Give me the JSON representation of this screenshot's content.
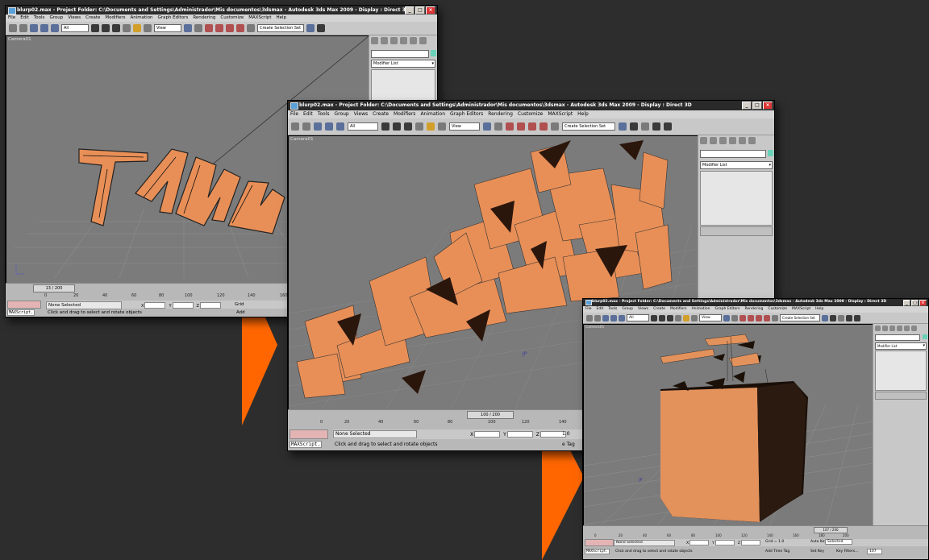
{
  "accent": {
    "arrow": "#ff6600",
    "object": "#e88f57",
    "titlebar": "#2a2a2a",
    "viewport": "#7b7b7b"
  },
  "menu": [
    "File",
    "Edit",
    "Tools",
    "Group",
    "Views",
    "Create",
    "Modifiers",
    "Animation",
    "Graph Editors",
    "Rendering",
    "Customize",
    "MAXScript",
    "Help"
  ],
  "window1": {
    "title": "blurp02.max    - Project Folder: C:\\Documents and Settings\\Administrador\\Mis documentos\\3dsmax    - Autodesk 3ds Max  2009    - Display : Direct 3D",
    "filter": "All",
    "refcoord": "View",
    "selset": "Create Selection Set",
    "viewport_label": "Camera01",
    "modifier_list": "Modifier List",
    "time_slider": "13 / 200",
    "ticks": [
      "0",
      "20",
      "40",
      "60",
      "80",
      "100",
      "120",
      "140",
      "160"
    ],
    "selection": "None Selected",
    "prompt": "Click and drag to select and rotate objects",
    "maxscript": "MAXScript.",
    "x_label": "X",
    "y_label": "Y",
    "z_label": "Z",
    "grid": "Grid",
    "add": "Add"
  },
  "window2": {
    "title": "blurp02.max    - Project Folder: C:\\Documents and Settings\\Administrador\\Mis documentos\\3dsmax    - Autodesk 3ds Max  2009    - Display : Direct 3D",
    "filter": "All",
    "refcoord": "View",
    "selset": "Create Selection Set",
    "viewport_label": "Camera01",
    "modifier_list": "Modifier List",
    "time_slider": "100 / 200",
    "ticks": [
      "0",
      "20",
      "40",
      "60",
      "80",
      "100",
      "120",
      "140"
    ],
    "selection": "None Selected",
    "prompt": "Click and drag to select and rotate objects",
    "maxscript": "MAXScript.",
    "x_label": "X",
    "y_label": "Y",
    "z_label": "Z",
    "grid": "1.0",
    "addtag": "e Tag"
  },
  "window3": {
    "title": "blurp02.max   - Project Folder: C:\\Documents and Settings\\Administrador\\Mis documentos\\3dsmax   - Autodesk 3ds Max  2009   - Display : Direct 3D",
    "filter": "All",
    "refcoord": "View",
    "selset": "Create Selection Set",
    "viewport_label": "Camera01",
    "modifier_list": "Modifier List",
    "time_slider": "107 / 200",
    "ticks": [
      "0",
      "20",
      "40",
      "60",
      "80",
      "100",
      "120",
      "140",
      "160",
      "180",
      "200"
    ],
    "selection": "None Selected",
    "prompt": "Click and drag to select and rotate objects",
    "maxscript": "MAXScript.",
    "x_label": "X",
    "y_label": "Y",
    "z_label": "Z",
    "grid": "Grid = 1.0",
    "addtimetag": "Add Time Tag",
    "autokey": "Auto Key",
    "setkey": "Set Key",
    "keyfilters": "Key Filters...",
    "selected": "Selected",
    "frame": "107"
  }
}
